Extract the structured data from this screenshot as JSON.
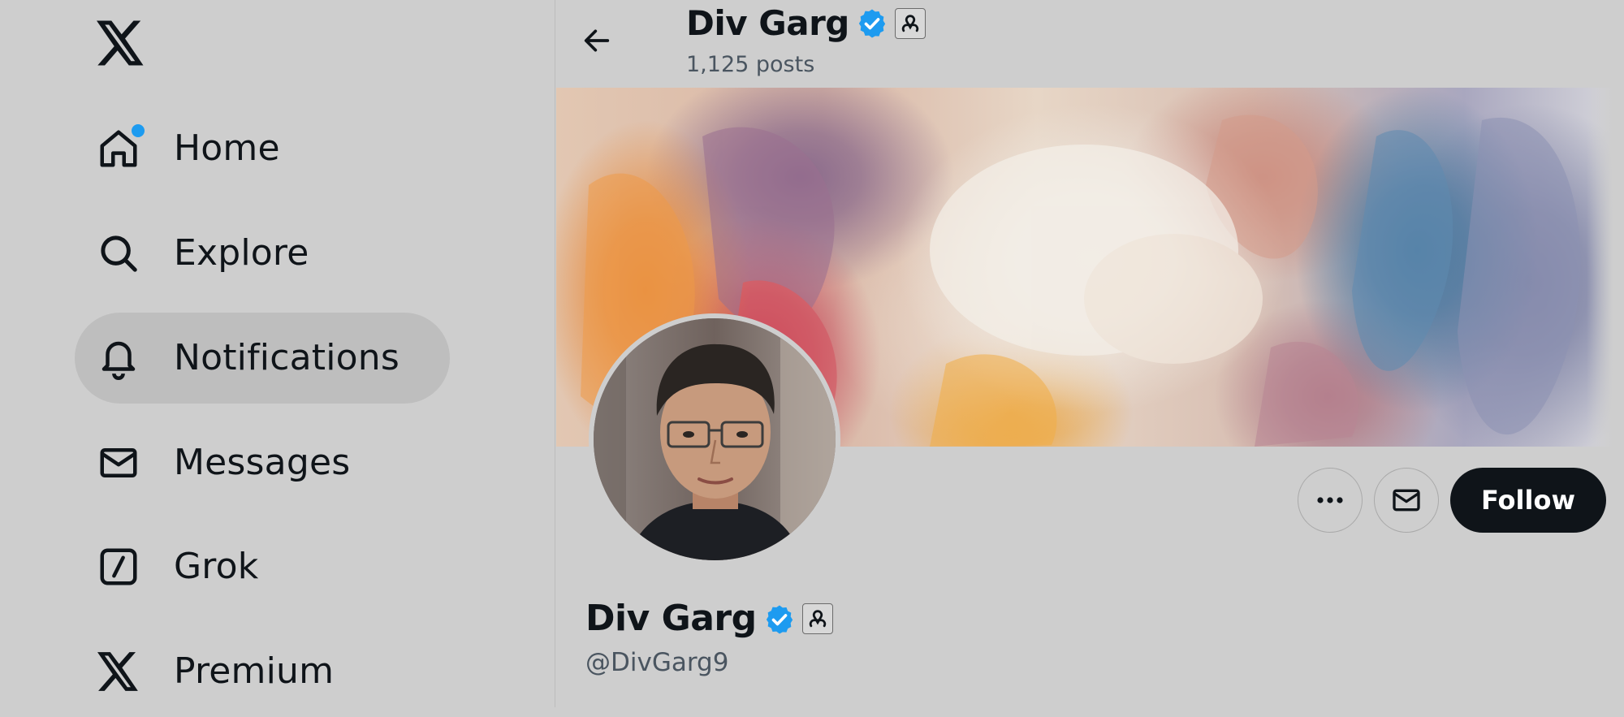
{
  "sidebar": {
    "logo": "x-logo-icon",
    "items": [
      {
        "label": "Home",
        "icon": "home-icon",
        "has_dot": true
      },
      {
        "label": "Explore",
        "icon": "search-icon"
      },
      {
        "label": "Notifications",
        "icon": "bell-icon",
        "active": true
      },
      {
        "label": "Messages",
        "icon": "envelope-icon"
      },
      {
        "label": "Grok",
        "icon": "grok-icon"
      },
      {
        "label": "Premium",
        "icon": "x-logo-icon"
      }
    ]
  },
  "header": {
    "name": "Div Garg",
    "posts": "1,125 posts"
  },
  "profile": {
    "name": "Div Garg",
    "handle": "@DivGarg9",
    "follow_label": "Follow"
  },
  "colors": {
    "accent": "#1d9bf0",
    "background": "#cecece",
    "active_nav": "#bebebe",
    "follow_button": "#0f1419"
  }
}
